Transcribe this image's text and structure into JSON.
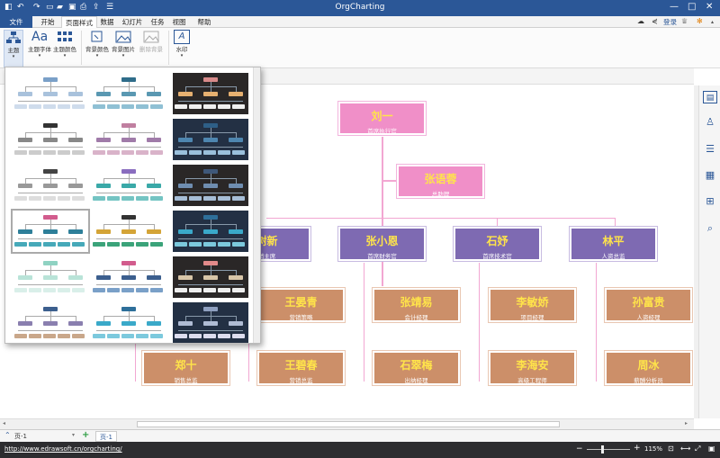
{
  "app": {
    "title": "OrgCharting"
  },
  "menu": {
    "file": "文件",
    "items": [
      "开始",
      "页面样式",
      "数据",
      "幻灯片",
      "任务",
      "视图",
      "帮助"
    ],
    "active_index": 1,
    "login": "登录"
  },
  "ribbon": {
    "theme": "主题",
    "theme_font": "主题字体",
    "theme_color": "主题颜色",
    "bg_color": "背景颜色",
    "bg_image": "背景图片",
    "remove_bg": "删除背景",
    "watermark": "水印"
  },
  "chart": {
    "ceo": {
      "name": "刘一",
      "title": "首席执行官"
    },
    "assistant": {
      "name": "张语蓉",
      "title": "总助理"
    },
    "managers": [
      {
        "name": "树新",
        "title": "销主席"
      },
      {
        "name": "张小恩",
        "title": "首席财务官"
      },
      {
        "name": "石妤",
        "title": "首席技术官"
      },
      {
        "name": "林平",
        "title": "人资总监"
      }
    ],
    "staff_row1": [
      {
        "name": "王晏青",
        "title": "营销策略"
      },
      {
        "name": "张靖易",
        "title": "会计经理"
      },
      {
        "name": "李敏娇",
        "title": "项目经理"
      },
      {
        "name": "孙富贵",
        "title": "人资经理"
      }
    ],
    "staff_row2": [
      {
        "name": "郑十",
        "title": "销售总监"
      },
      {
        "name": "王碧春",
        "title": "营销总监"
      },
      {
        "name": "石翠梅",
        "title": "出纳经理"
      },
      {
        "name": "李海安",
        "title": "高级工程师"
      },
      {
        "name": "周冰",
        "title": "薪酬分析员"
      }
    ]
  },
  "pages": {
    "current": "页-1",
    "tab": "页-1"
  },
  "status": {
    "url": "http://www.edrawsoft.cn/orgcharting/",
    "zoom": "115%"
  },
  "colors": {
    "brand": "#2b5797",
    "pink": "#f08fc8",
    "purple": "#7e6ab2",
    "tan": "#cc8f69",
    "name_yellow": "#ffe44a"
  }
}
